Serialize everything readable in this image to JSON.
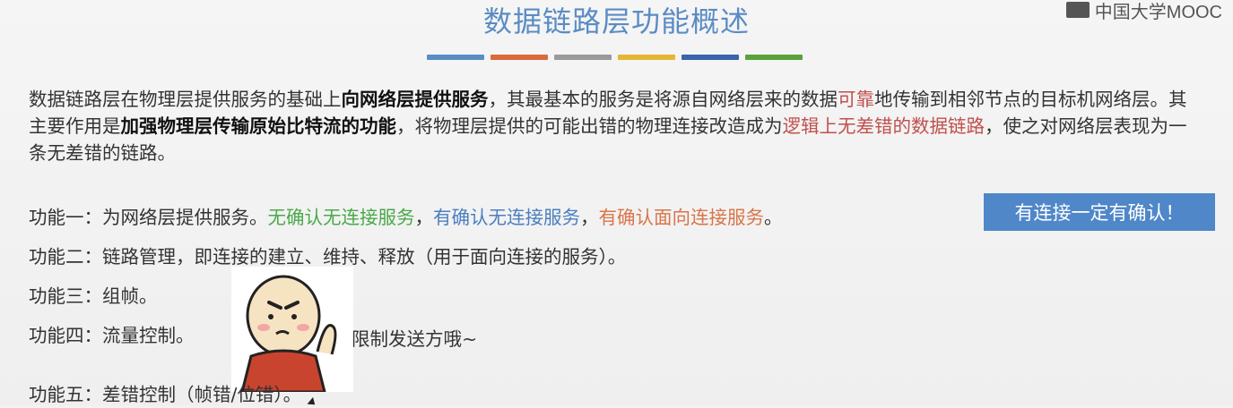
{
  "title": "数据链路层功能概述",
  "logo_text": "中国大学MOOC",
  "bar_colors": [
    "#5b8cc4",
    "#d86b3a",
    "#9a9a9a",
    "#e3b635",
    "#3c64a8",
    "#5aa13e"
  ],
  "intro": {
    "p1": "数据链路层在物理层提供服务的基础上",
    "p2": "向网络层提供服务",
    "p3": "，其最基本的服务是将源自网络层来的数据",
    "p4": "可靠",
    "p5": "地传输到相邻节点的目标机网络层。其主要作用是",
    "p6": "加强物理层传输原始比特流的功能",
    "p7": "，将物理层提供的可能出错的物理连接改造成为",
    "p8": "逻辑上无差错的数据链路",
    "p9": "，使之对网络层表现为一条无差错的链路。"
  },
  "functions": {
    "f1_prefix": "功能一：为网络层提供服务。",
    "f1_s1": "无确认无连接服务",
    "f1_sep1": "，",
    "f1_s2": "有确认无连接服务",
    "f1_sep2": "，",
    "f1_s3": "有确认面向连接服务",
    "f1_end": "。",
    "f2": "功能二：链路管理，即连接的建立、维持、释放（用于面向连接的服务）。",
    "f3": "功能三：组帧。",
    "f4": "功能四：流量控制。",
    "f5": "功能五：差错控制（帧错/位错）。"
  },
  "callout": "有连接一定有确认！",
  "sticker_caption": "限制发送方哦~"
}
